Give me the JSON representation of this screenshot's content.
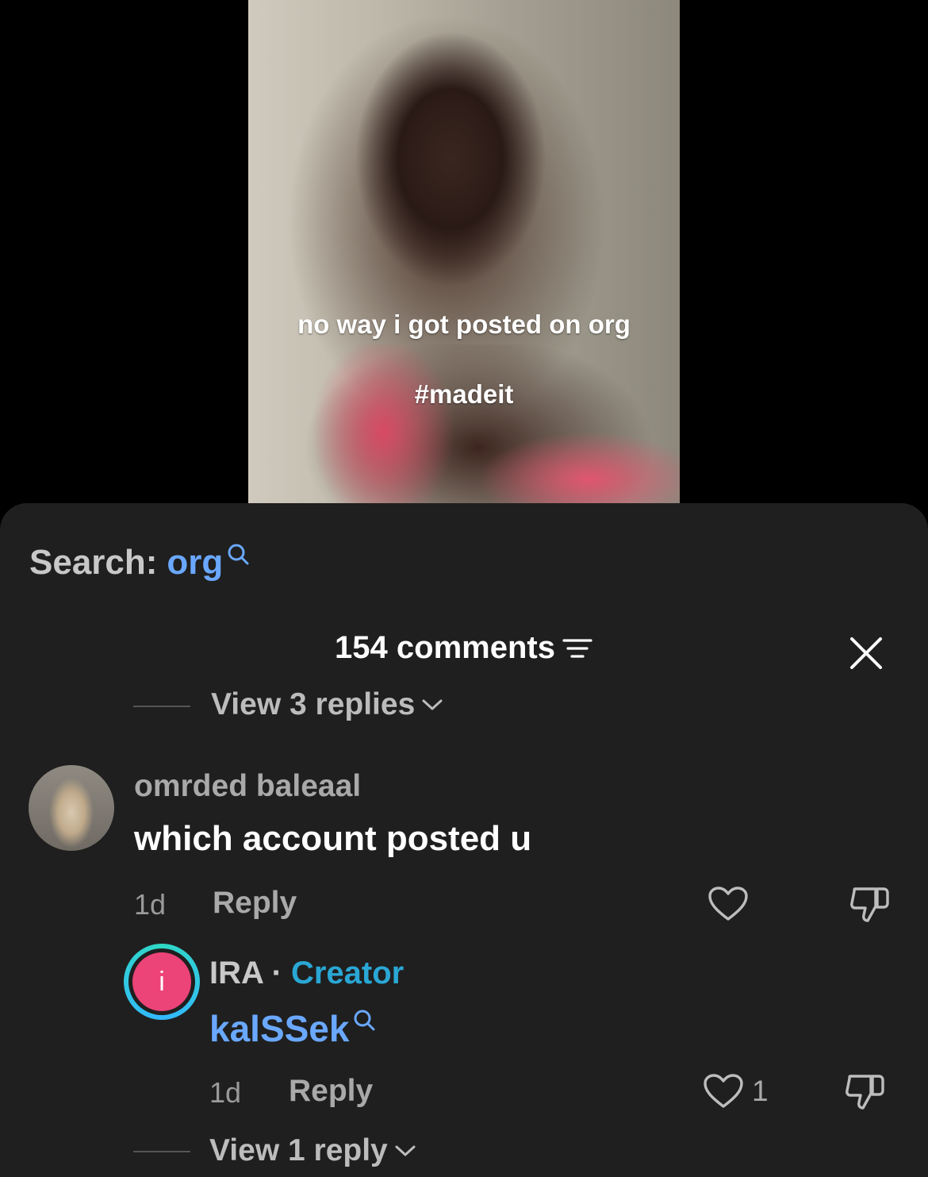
{
  "video": {
    "caption_line1": "no way i got posted on org",
    "caption_line2": "#madeit"
  },
  "search": {
    "label": "Search:",
    "term": "org"
  },
  "comments_header": {
    "count_label": "154 comments"
  },
  "view_replies_top": "View 3 replies",
  "comment": {
    "username": "omrded baleaal",
    "text": "which account posted u",
    "time": "1d",
    "reply_label": "Reply"
  },
  "creator_reply": {
    "avatar_letter": "i",
    "name": "IRA",
    "separator": " · ",
    "badge": "Creator",
    "text": "kalSSek",
    "time": "1d",
    "reply_label": "Reply",
    "like_count": "1"
  },
  "view_replies_bottom": "View 1 reply",
  "colors": {
    "sheet_bg": "#1f1f1f",
    "link_blue": "#6aa8ff",
    "creator_teal": "#2aa7d4",
    "avatar_pink": "#ec4378"
  }
}
